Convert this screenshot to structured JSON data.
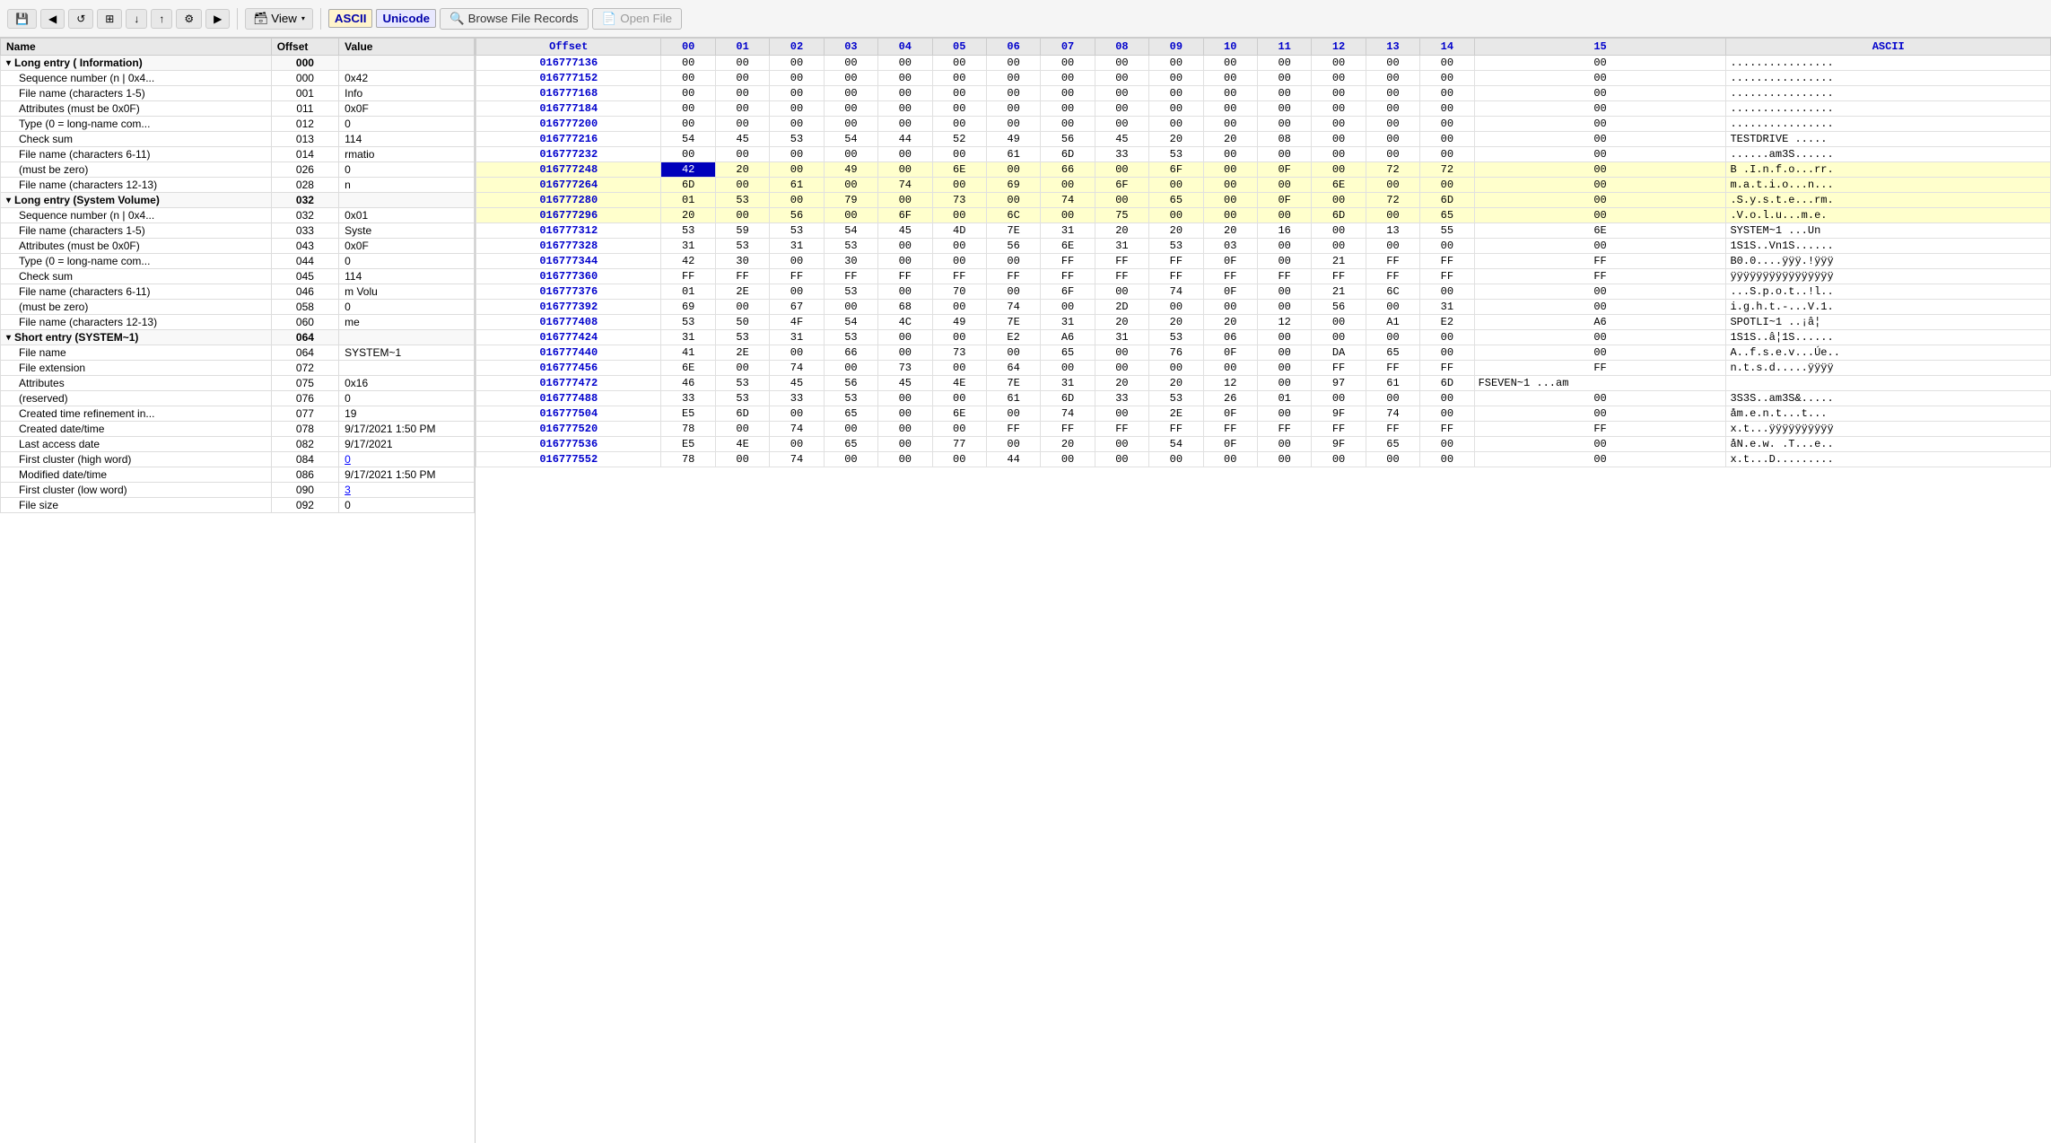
{
  "toolbar": {
    "view_label": "View",
    "ascii_label": "ASCII",
    "unicode_label": "Unicode",
    "browse_label": "Browse File Records",
    "open_label": "Open File"
  },
  "left": {
    "columns": [
      "Name",
      "Offset",
      "Value"
    ],
    "groups": [
      {
        "label": "Long entry ( Information)",
        "offset": "000",
        "value": "",
        "children": [
          {
            "name": "Sequence number (n | 0x4...",
            "offset": "000",
            "value": "0x42",
            "link": false
          },
          {
            "name": "File name (characters 1-5)",
            "offset": "001",
            "value": "Info",
            "link": false
          },
          {
            "name": "Attributes (must be 0x0F)",
            "offset": "011",
            "value": "0x0F",
            "link": false
          },
          {
            "name": "Type (0 = long-name com...",
            "offset": "012",
            "value": "0",
            "link": false
          },
          {
            "name": "Check sum",
            "offset": "013",
            "value": "114",
            "link": false
          },
          {
            "name": "File name (characters 6-11)",
            "offset": "014",
            "value": "rmatio",
            "link": false
          },
          {
            "name": "(must be zero)",
            "offset": "026",
            "value": "0",
            "link": false
          },
          {
            "name": "File name (characters 12-13)",
            "offset": "028",
            "value": "n",
            "link": false
          }
        ]
      },
      {
        "label": "Long entry (System Volume)",
        "offset": "032",
        "value": "",
        "children": [
          {
            "name": "Sequence number (n | 0x4...",
            "offset": "032",
            "value": "0x01",
            "link": false
          },
          {
            "name": "File name (characters 1-5)",
            "offset": "033",
            "value": "Syste",
            "link": false
          },
          {
            "name": "Attributes (must be 0x0F)",
            "offset": "043",
            "value": "0x0F",
            "link": false
          },
          {
            "name": "Type (0 = long-name com...",
            "offset": "044",
            "value": "0",
            "link": false
          },
          {
            "name": "Check sum",
            "offset": "045",
            "value": "114",
            "link": false
          },
          {
            "name": "File name (characters 6-11)",
            "offset": "046",
            "value": "m Volu",
            "link": false
          },
          {
            "name": "(must be zero)",
            "offset": "058",
            "value": "0",
            "link": false
          },
          {
            "name": "File name (characters 12-13)",
            "offset": "060",
            "value": "me",
            "link": false
          }
        ]
      },
      {
        "label": "Short entry (SYSTEM~1)",
        "offset": "064",
        "value": "",
        "children": [
          {
            "name": "File name",
            "offset": "064",
            "value": "SYSTEM~1",
            "link": false
          },
          {
            "name": "File extension",
            "offset": "072",
            "value": "",
            "link": false
          },
          {
            "name": "Attributes",
            "offset": "075",
            "value": "0x16",
            "link": false
          },
          {
            "name": "(reserved)",
            "offset": "076",
            "value": "0",
            "link": false
          },
          {
            "name": "Created time refinement in...",
            "offset": "077",
            "value": "19",
            "link": false
          },
          {
            "name": "Created date/time",
            "offset": "078",
            "value": "9/17/2021 1:50 PM",
            "link": false
          },
          {
            "name": "Last access date",
            "offset": "082",
            "value": "9/17/2021",
            "link": false
          },
          {
            "name": "First cluster (high word)",
            "offset": "084",
            "value": "0",
            "link": true
          },
          {
            "name": "Modified date/time",
            "offset": "086",
            "value": "9/17/2021 1:50 PM",
            "link": false
          },
          {
            "name": "First cluster (low word)",
            "offset": "090",
            "value": "3",
            "link": true
          },
          {
            "name": "File size",
            "offset": "092",
            "value": "0",
            "link": false
          }
        ]
      }
    ]
  },
  "hex": {
    "columns": [
      "Offset",
      "00",
      "01",
      "02",
      "03",
      "04",
      "05",
      "06",
      "07",
      "08",
      "09",
      "10",
      "11",
      "12",
      "13",
      "14",
      "15",
      "ASCII"
    ],
    "rows": [
      {
        "offset": "016777136",
        "bytes": [
          "00",
          "00",
          "00",
          "00",
          "00",
          "00",
          "00",
          "00",
          "00",
          "00",
          "00",
          "00",
          "00",
          "00",
          "00",
          "00"
        ],
        "ascii": "................",
        "style": ""
      },
      {
        "offset": "016777152",
        "bytes": [
          "00",
          "00",
          "00",
          "00",
          "00",
          "00",
          "00",
          "00",
          "00",
          "00",
          "00",
          "00",
          "00",
          "00",
          "00",
          "00"
        ],
        "ascii": "................",
        "style": ""
      },
      {
        "offset": "016777168",
        "bytes": [
          "00",
          "00",
          "00",
          "00",
          "00",
          "00",
          "00",
          "00",
          "00",
          "00",
          "00",
          "00",
          "00",
          "00",
          "00",
          "00"
        ],
        "ascii": "................",
        "style": ""
      },
      {
        "offset": "016777184",
        "bytes": [
          "00",
          "00",
          "00",
          "00",
          "00",
          "00",
          "00",
          "00",
          "00",
          "00",
          "00",
          "00",
          "00",
          "00",
          "00",
          "00"
        ],
        "ascii": "................",
        "style": ""
      },
      {
        "offset": "016777200",
        "bytes": [
          "00",
          "00",
          "00",
          "00",
          "00",
          "00",
          "00",
          "00",
          "00",
          "00",
          "00",
          "00",
          "00",
          "00",
          "00",
          "00"
        ],
        "ascii": "................",
        "style": ""
      },
      {
        "offset": "016777216",
        "bytes": [
          "54",
          "45",
          "53",
          "54",
          "44",
          "52",
          "49",
          "56",
          "45",
          "20",
          "20",
          "08",
          "00",
          "00",
          "00",
          "00"
        ],
        "ascii": "TESTDRIVE   .....",
        "style": ""
      },
      {
        "offset": "016777232",
        "bytes": [
          "00",
          "00",
          "00",
          "00",
          "00",
          "00",
          "61",
          "6D",
          "33",
          "53",
          "00",
          "00",
          "00",
          "00",
          "00",
          "00"
        ],
        "ascii": "......am3S......",
        "style": ""
      },
      {
        "offset": "016777248",
        "bytes": [
          "42",
          "20",
          "00",
          "49",
          "00",
          "6E",
          "00",
          "66",
          "00",
          "6F",
          "00",
          "0F",
          "00",
          "72",
          "72",
          "00"
        ],
        "ascii": "B .I.n.f.o...rr.",
        "style": "yellow",
        "selected": 0
      },
      {
        "offset": "016777264",
        "bytes": [
          "6D",
          "00",
          "61",
          "00",
          "74",
          "00",
          "69",
          "00",
          "6F",
          "00",
          "00",
          "00",
          "6E",
          "00",
          "00",
          "00"
        ],
        "ascii": "m.a.t.i.o...n...",
        "style": "yellow"
      },
      {
        "offset": "016777280",
        "bytes": [
          "01",
          "53",
          "00",
          "79",
          "00",
          "73",
          "00",
          "74",
          "00",
          "65",
          "00",
          "0F",
          "00",
          "72",
          "6D",
          "00"
        ],
        "ascii": ".S.y.s.t.e...rm.",
        "style": "yellow"
      },
      {
        "offset": "016777296",
        "bytes": [
          "20",
          "00",
          "56",
          "00",
          "6F",
          "00",
          "6C",
          "00",
          "75",
          "00",
          "00",
          "00",
          "6D",
          "00",
          "65",
          "00"
        ],
        "ascii": " .V.o.l.u...m.e.",
        "style": "yellow"
      },
      {
        "offset": "016777312",
        "bytes": [
          "53",
          "59",
          "53",
          "54",
          "45",
          "4D",
          "7E",
          "31",
          "20",
          "20",
          "20",
          "16",
          "00",
          "13",
          "55",
          "6E"
        ],
        "ascii": "SYSTEM~1   ...Un",
        "style": ""
      },
      {
        "offset": "016777328",
        "bytes": [
          "31",
          "53",
          "31",
          "53",
          "00",
          "00",
          "56",
          "6E",
          "31",
          "53",
          "03",
          "00",
          "00",
          "00",
          "00",
          "00"
        ],
        "ascii": "1S1S..Vn1S......",
        "style": ""
      },
      {
        "offset": "016777344",
        "bytes": [
          "42",
          "30",
          "00",
          "30",
          "00",
          "00",
          "00",
          "FF",
          "FF",
          "FF",
          "0F",
          "00",
          "21",
          "FF",
          "FF",
          "FF"
        ],
        "ascii": "B0.0....ÿÿÿ.!ÿÿÿ",
        "style": ""
      },
      {
        "offset": "016777360",
        "bytes": [
          "FF",
          "FF",
          "FF",
          "FF",
          "FF",
          "FF",
          "FF",
          "FF",
          "FF",
          "FF",
          "FF",
          "FF",
          "FF",
          "FF",
          "FF",
          "FF"
        ],
        "ascii": "ÿÿÿÿÿÿÿÿÿÿÿÿÿÿÿÿ",
        "style": ""
      },
      {
        "offset": "016777376",
        "bytes": [
          "01",
          "2E",
          "00",
          "53",
          "00",
          "70",
          "00",
          "6F",
          "00",
          "74",
          "0F",
          "00",
          "21",
          "6C",
          "00",
          "00"
        ],
        "ascii": "...S.p.o.t..!l..",
        "style": ""
      },
      {
        "offset": "016777392",
        "bytes": [
          "69",
          "00",
          "67",
          "00",
          "68",
          "00",
          "74",
          "00",
          "2D",
          "00",
          "00",
          "00",
          "56",
          "00",
          "31",
          "00"
        ],
        "ascii": "i.g.h.t.-...V.1.",
        "style": ""
      },
      {
        "offset": "016777408",
        "bytes": [
          "53",
          "50",
          "4F",
          "54",
          "4C",
          "49",
          "7E",
          "31",
          "20",
          "20",
          "20",
          "12",
          "00",
          "A1",
          "E2",
          "A6"
        ],
        "ascii": "SPOTLI~1   ..¡â¦",
        "style": ""
      },
      {
        "offset": "016777424",
        "bytes": [
          "31",
          "53",
          "31",
          "53",
          "00",
          "00",
          "E2",
          "A6",
          "31",
          "53",
          "06",
          "00",
          "00",
          "00",
          "00",
          "00"
        ],
        "ascii": "1S1S..â¦1S......",
        "style": ""
      },
      {
        "offset": "016777440",
        "bytes": [
          "41",
          "2E",
          "00",
          "66",
          "00",
          "73",
          "00",
          "65",
          "00",
          "76",
          "0F",
          "00",
          "DA",
          "65",
          "00",
          "00"
        ],
        "ascii": "A..f.s.e.v...Úe..",
        "style": ""
      },
      {
        "offset": "016777456",
        "bytes": [
          "6E",
          "00",
          "74",
          "00",
          "73",
          "00",
          "64",
          "00",
          "00",
          "00",
          "00",
          "00",
          "FF",
          "FF",
          "FF",
          "FF"
        ],
        "ascii": "n.t.s.d.....ÿÿÿÿ",
        "style": ""
      },
      {
        "offset": "016777472",
        "bytes": [
          "46",
          "53",
          "45",
          "56",
          "45",
          "4E",
          "7E",
          "31",
          "20",
          "20",
          "12",
          "00",
          "97",
          "61",
          "6D"
        ],
        "ascii": "FSEVEN~1   ...am",
        "style": ""
      },
      {
        "offset": "016777488",
        "bytes": [
          "33",
          "53",
          "33",
          "53",
          "00",
          "00",
          "61",
          "6D",
          "33",
          "53",
          "26",
          "01",
          "00",
          "00",
          "00",
          "00"
        ],
        "ascii": "3S3S..am3S&.....",
        "style": ""
      },
      {
        "offset": "016777504",
        "bytes": [
          "E5",
          "6D",
          "00",
          "65",
          "00",
          "6E",
          "00",
          "74",
          "00",
          "2E",
          "0F",
          "00",
          "9F",
          "74",
          "00",
          "00"
        ],
        "ascii": "åm.e.n.t...t...",
        "style": ""
      },
      {
        "offset": "016777520",
        "bytes": [
          "78",
          "00",
          "74",
          "00",
          "00",
          "00",
          "FF",
          "FF",
          "FF",
          "FF",
          "FF",
          "FF",
          "FF",
          "FF",
          "FF",
          "FF"
        ],
        "ascii": "x.t...ÿÿÿÿÿÿÿÿÿÿ",
        "style": ""
      },
      {
        "offset": "016777536",
        "bytes": [
          "E5",
          "4E",
          "00",
          "65",
          "00",
          "77",
          "00",
          "20",
          "00",
          "54",
          "0F",
          "00",
          "9F",
          "65",
          "00",
          "00"
        ],
        "ascii": "åN.e.w. .T...e..",
        "style": ""
      },
      {
        "offset": "016777552",
        "bytes": [
          "78",
          "00",
          "74",
          "00",
          "00",
          "00",
          "44",
          "00",
          "00",
          "00",
          "00",
          "00",
          "00",
          "00",
          "00",
          "00"
        ],
        "ascii": "x.t...D.........",
        "style": ""
      }
    ]
  }
}
